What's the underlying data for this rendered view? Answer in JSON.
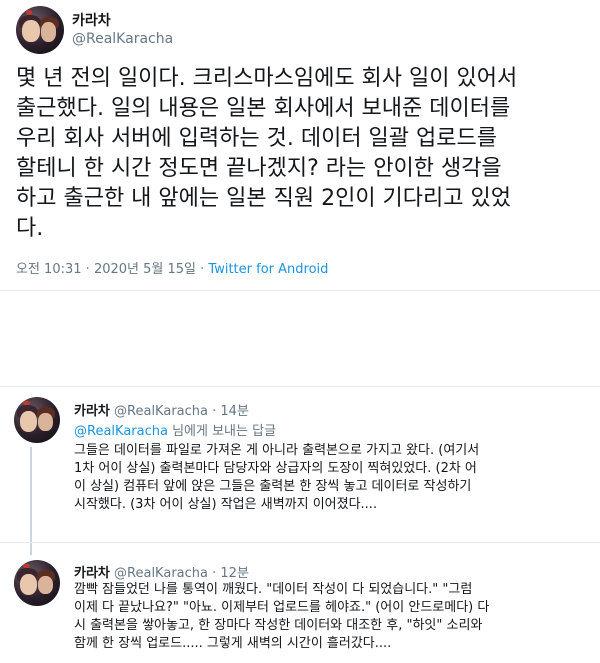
{
  "main_tweet": {
    "display_name": "카라차",
    "handle": "@RealKaracha",
    "text": "몇 년 전의 일이다. 크리스마스임에도 회사 일이 있어서\n출근했다. 일의 내용은 일본 회사에서 보내준 데이터를\n우리 회사 서버에 입력하는 것. 데이터 일괄 업로드를\n할테니 한 시간 정도면 끝나겠지? 라는 안이한 생각을\n하고 출근한 내 앞에는 일본 직원 2인이 기다리고 있었\n다.",
    "time": "오전 10:31",
    "date": "2020년 5월 15일",
    "separator": "·",
    "source": "Twitter for Android"
  },
  "replies": [
    {
      "display_name": "카라차",
      "handle": "@RealKaracha",
      "age": "14분",
      "separator": "·",
      "replying_to_mention": "@RealKaracha",
      "replying_suffix": " 님에게 보내는 답글",
      "text": "그들은 데이터를 파일로 가져온 게 아니라 출력본으로 가지고 왔다. (여기서\n1차 어이 상실) 출력본마다 담당자와 상급자의 도장이 찍혀있었다. (2차 어\n이 상실) 컴퓨터 앞에 앉은 그들은 출력본 한 장씩 놓고 데이터로 작성하기\n시작했다. (3차 어이 상실) 작업은 새벽까지 이어졌다...."
    },
    {
      "display_name": "카라차",
      "handle": "@RealKaracha",
      "age": "12분",
      "separator": "·",
      "text": "깜빡 잠들었던 나를 통역이 깨웠다. \"데이터 작성이 다 되었습니다.\" \"그럼\n이제 다 끝났나요?\" \"아뇨. 이제부터 업로드를 헤야죠.\" (어이 안드로메다) 다\n시 출력본을 쌓아놓고, 한 장마다 작성한 데이터와 대조한 후, \"하잇\" 소리와\n함께 한 장씩 업로드..... 그렇게 새벽의 시간이 흘러갔다...."
    }
  ]
}
